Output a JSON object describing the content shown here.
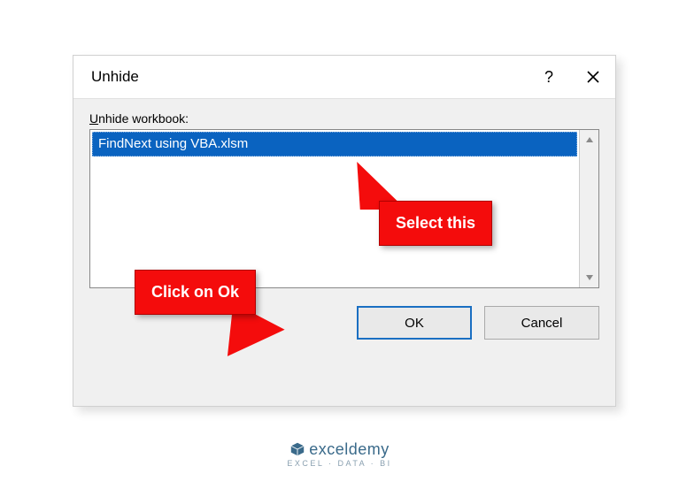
{
  "dialog": {
    "title": "Unhide",
    "label_prefix": "U",
    "label_rest": "nhide workbook:",
    "items": [
      "FindNext using VBA.xlsm"
    ],
    "ok": "OK",
    "cancel": "Cancel"
  },
  "callouts": {
    "select": "Select this",
    "ok": "Click on Ok"
  },
  "branding": {
    "name": "exceldemy",
    "tagline": "EXCEL · DATA · BI"
  }
}
